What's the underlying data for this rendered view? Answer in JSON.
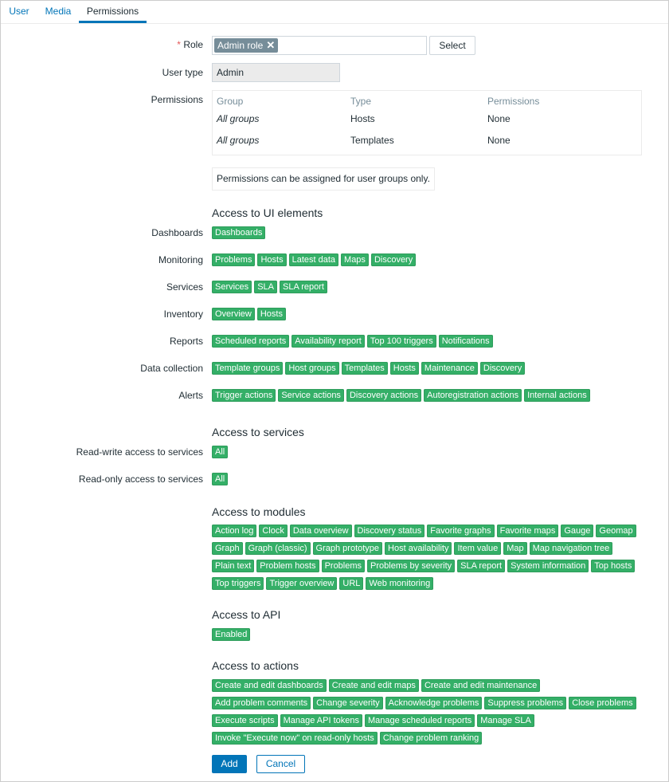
{
  "tabs": [
    {
      "label": "User",
      "active": false
    },
    {
      "label": "Media",
      "active": false
    },
    {
      "label": "Permissions",
      "active": true
    }
  ],
  "form": {
    "role": {
      "required_mark": "*",
      "label": "Role",
      "selected_chip": "Admin role",
      "remove_icon": "close-icon",
      "select_button": "Select"
    },
    "user_type": {
      "label": "User type",
      "value": "Admin"
    },
    "permissions": {
      "label": "Permissions",
      "columns": [
        "Group",
        "Type",
        "Permissions"
      ],
      "rows": [
        {
          "group": "All groups",
          "type": "Hosts",
          "permission": "None"
        },
        {
          "group": "All groups",
          "type": "Templates",
          "permission": "None"
        }
      ],
      "info": "Permissions can be assigned for user groups only."
    }
  },
  "ui_elements": {
    "title": "Access to UI elements",
    "rows": [
      {
        "label": "Dashboards",
        "tags": [
          "Dashboards"
        ]
      },
      {
        "label": "Monitoring",
        "tags": [
          "Problems",
          "Hosts",
          "Latest data",
          "Maps",
          "Discovery"
        ]
      },
      {
        "label": "Services",
        "tags": [
          "Services",
          "SLA",
          "SLA report"
        ]
      },
      {
        "label": "Inventory",
        "tags": [
          "Overview",
          "Hosts"
        ]
      },
      {
        "label": "Reports",
        "tags": [
          "Scheduled reports",
          "Availability report",
          "Top 100 triggers",
          "Notifications"
        ]
      },
      {
        "label": "Data collection",
        "tags": [
          "Template groups",
          "Host groups",
          "Templates",
          "Hosts",
          "Maintenance",
          "Discovery"
        ]
      },
      {
        "label": "Alerts",
        "tags": [
          "Trigger actions",
          "Service actions",
          "Discovery actions",
          "Autoregistration actions",
          "Internal actions"
        ]
      }
    ]
  },
  "services": {
    "title": "Access to services",
    "rows": [
      {
        "label": "Read-write access to services",
        "tags": [
          "All"
        ]
      },
      {
        "label": "Read-only access to services",
        "tags": [
          "All"
        ]
      }
    ]
  },
  "modules": {
    "title": "Access to modules",
    "lines": [
      [
        "Action log",
        "Clock",
        "Data overview",
        "Discovery status",
        "Favorite graphs",
        "Favorite maps",
        "Gauge",
        "Geomap"
      ],
      [
        "Graph",
        "Graph (classic)",
        "Graph prototype",
        "Host availability",
        "Item value",
        "Map",
        "Map navigation tree"
      ],
      [
        "Plain text",
        "Problem hosts",
        "Problems",
        "Problems by severity",
        "SLA report",
        "System information",
        "Top hosts"
      ],
      [
        "Top triggers",
        "Trigger overview",
        "URL",
        "Web monitoring"
      ]
    ]
  },
  "api": {
    "title": "Access to API",
    "tags": [
      "Enabled"
    ]
  },
  "actions": {
    "title": "Access to actions",
    "lines": [
      [
        "Create and edit dashboards",
        "Create and edit maps",
        "Create and edit maintenance"
      ],
      [
        "Add problem comments",
        "Change severity",
        "Acknowledge problems",
        "Suppress problems",
        "Close problems"
      ],
      [
        "Execute scripts",
        "Manage API tokens",
        "Manage scheduled reports",
        "Manage SLA"
      ],
      [
        "Invoke \"Execute now\" on read-only hosts",
        "Change problem ranking"
      ]
    ]
  },
  "buttons": {
    "add": "Add",
    "cancel": "Cancel"
  },
  "colors": {
    "accent": "#0275b8",
    "tag_green": "#34af67",
    "chip_gray": "#768d99",
    "required": "#e45959"
  }
}
